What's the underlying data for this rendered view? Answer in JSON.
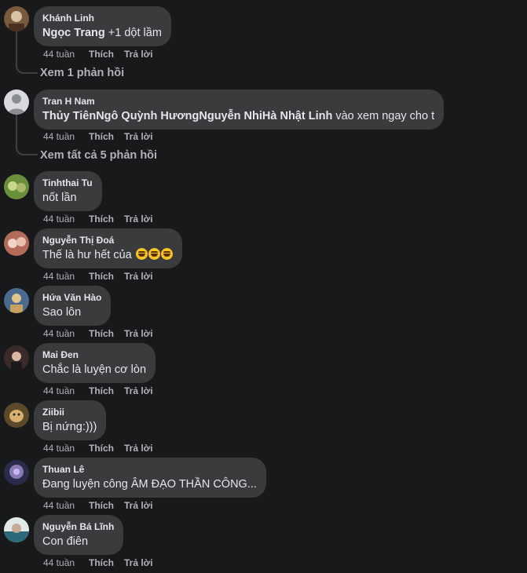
{
  "comments": [
    {
      "author": "Khánh Linh",
      "mention": "Ngọc Trang",
      "text": " +1 dột lầm",
      "time": "44 tuần",
      "like": "Thích",
      "reply": "Trả lời",
      "replies": "Xem 1 phản hồi",
      "avatar_colors": [
        "#7a5a3c",
        "#d8c3a5"
      ]
    },
    {
      "author": "Tran H Nam",
      "mention": "Thủy TiênNgô Quỳnh HươngNguyễn NhiHà Nhật Linh",
      "text": " vào xem ngay cho t",
      "time": "44 tuần",
      "like": "Thích",
      "reply": "Trả lời",
      "replies": "Xem tất cả 5 phản hồi",
      "avatar_colors": [
        "#d8dadf",
        "#8a8d91"
      ]
    },
    {
      "author": "Tinhthai Tu",
      "text": "nốt lần",
      "time": "44 tuần",
      "like": "Thích",
      "reply": "Trả lời",
      "avatar_colors": [
        "#6a8f3a",
        "#c9d78a"
      ]
    },
    {
      "author": "Nguyễn Thị Đoá",
      "text": "Thế là hư hết của ",
      "time": "44 tuần",
      "like": "Thích",
      "reply": "Trả lời",
      "emoji_count": 3,
      "avatar_colors": [
        "#b26a5a",
        "#f1d4c8"
      ]
    },
    {
      "author": "Hứa Văn Hào",
      "text": "Sao lôn",
      "time": "44 tuần",
      "like": "Thích",
      "reply": "Trả lời",
      "avatar_colors": [
        "#4a6a8f",
        "#e0c48a"
      ]
    },
    {
      "author": "Mai Đen",
      "text": "Chắc là luyện cơ lòn",
      "time": "44 tuần",
      "like": "Thích",
      "reply": "Trả lời",
      "avatar_colors": [
        "#3a2a2a",
        "#d9b8a8"
      ]
    },
    {
      "author": "Ziibii",
      "text": "Bị nứng:)))",
      "time": "44 tuần",
      "like": "Thích",
      "reply": "Trả lời",
      "avatar_colors": [
        "#5a4a2a",
        "#d8b070"
      ]
    },
    {
      "author": "Thuan Lê",
      "text": "Đang luyện công ÂM ĐẠO THẦN CÔNG...",
      "time": "44 tuần",
      "like": "Thích",
      "reply": "Trả lời",
      "avatar_colors": [
        "#2a2a4a",
        "#8a7ab8"
      ]
    },
    {
      "author": "Nguyễn Bá Lĩnh",
      "text": "Con điên",
      "time": "44 tuần",
      "like": "Thích",
      "reply": "Trả lời",
      "avatar_colors": [
        "#2a6a7a",
        "#e0e8e8"
      ]
    }
  ]
}
